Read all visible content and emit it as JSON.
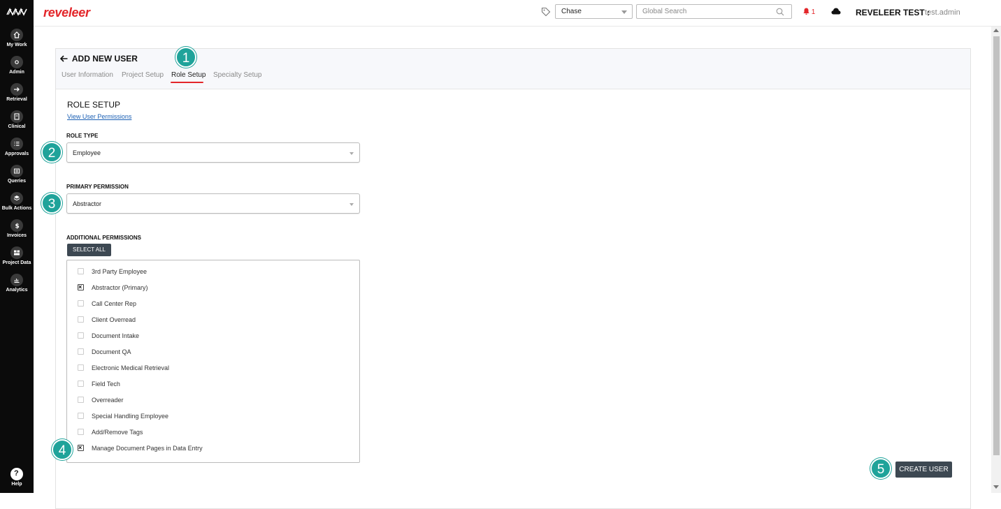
{
  "sidebar": {
    "items": [
      {
        "label": "My Work",
        "icon": "home-icon"
      },
      {
        "label": "Admin",
        "icon": "admin-icon"
      },
      {
        "label": "Retrieval",
        "icon": "arrow-icon"
      },
      {
        "label": "Clinical",
        "icon": "clinical-icon"
      },
      {
        "label": "Approvals",
        "icon": "approvals-icon"
      },
      {
        "label": "Queries",
        "icon": "queries-icon"
      },
      {
        "label": "Bulk Actions",
        "icon": "layers-icon"
      },
      {
        "label": "Invoices",
        "icon": "dollar-icon"
      },
      {
        "label": "Project Data",
        "icon": "project-data-icon"
      },
      {
        "label": "Analytics",
        "icon": "analytics-icon"
      }
    ],
    "help_label": "Help"
  },
  "header": {
    "brand": "reveleer",
    "project_select": "Chase",
    "search_placeholder": "Global Search",
    "notification_count": "1",
    "user_name": "REVELEER TEST :",
    "user_id": "test.admin"
  },
  "page": {
    "title": "ADD NEW USER",
    "tabs": [
      "User Information",
      "Project Setup",
      "Role Setup",
      "Specialty Setup"
    ],
    "active_tab": "Role Setup",
    "section_title": "ROLE SETUP",
    "permissions_link": "View User Permissions",
    "role_type_label": "ROLE TYPE",
    "role_type_value": "Employee",
    "primary_permission_label": "PRIMARY PERMISSION",
    "primary_permission_value": "Abstractor",
    "additional_permissions_label": "ADDITIONAL PERMISSIONS",
    "select_all_label": "SELECT ALL",
    "permissions": [
      {
        "label": "3rd Party Employee",
        "checked": false
      },
      {
        "label": "Abstractor (Primary)",
        "checked": true
      },
      {
        "label": "Call Center Rep",
        "checked": false
      },
      {
        "label": "Client Overread",
        "checked": false
      },
      {
        "label": "Document Intake",
        "checked": false
      },
      {
        "label": "Document QA",
        "checked": false
      },
      {
        "label": "Electronic Medical Retrieval",
        "checked": false
      },
      {
        "label": "Field Tech",
        "checked": false
      },
      {
        "label": "Overreader",
        "checked": false
      },
      {
        "label": "Special Handling Employee",
        "checked": false
      },
      {
        "label": "Add/Remove Tags",
        "checked": false
      },
      {
        "label": "Manage Document Pages in Data Entry",
        "checked": true
      }
    ],
    "create_button": "CREATE USER"
  },
  "callouts": [
    "1",
    "2",
    "3",
    "4",
    "5"
  ],
  "colors": {
    "brand": "#e3262a",
    "callout": "#1fa39a",
    "button": "#3d4852",
    "sidebar": "#0b0b0b"
  }
}
